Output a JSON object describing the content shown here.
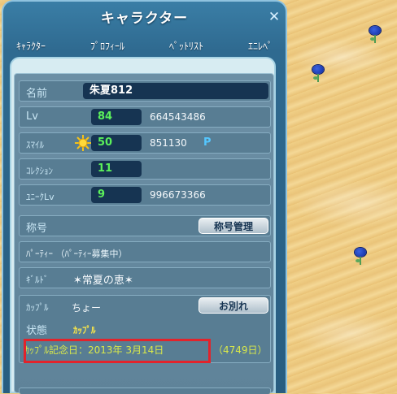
{
  "window": {
    "title": "キャラクター",
    "tabs": [
      "ｷｬﾗｸﾀｰ",
      "ﾌﾟﾛﾌｨｰﾙ",
      "ﾍﾟｯﾄﾘｽﾄ",
      "ｴﾆﾚﾍﾟ"
    ]
  },
  "profile": {
    "name_label": "名前",
    "name": "朱夏812",
    "lv_label": "Lv",
    "lv": "84",
    "lv_exp": "664543486",
    "smile_label": "ｽﾏｲﾙ",
    "smile": "50",
    "smile_points": "851130",
    "smile_unit": "P",
    "collection_label": "ｺﾚｸｼｮﾝ",
    "collection": "11",
    "unique_label": "ﾕﾆｰｸLv",
    "unique": "9",
    "unique_exp": "996673366",
    "title_label": "称号",
    "title_button": "称号管理",
    "party": "ﾊﾟｰﾃｨｰ （ﾊﾟｰﾃｨｰ募集中）",
    "guild_label": "ｷﾞﾙﾄﾞ",
    "guild": "✶常夏の恵✶",
    "couple_label": "ｶｯﾌﾟﾙ",
    "couple_partner": "ちょー",
    "breakup_button": "お別れ",
    "status_label": "状態",
    "status_value": "ｶｯﾌﾟﾙ",
    "anniversary": "ｶｯﾌﾟﾙ記念日：2013年 3月14日",
    "days": "（4749日）"
  },
  "colors": {
    "accent_green": "#5bf05b",
    "highlight": "#e2232b",
    "anniversary_text": "#d9e84a"
  }
}
